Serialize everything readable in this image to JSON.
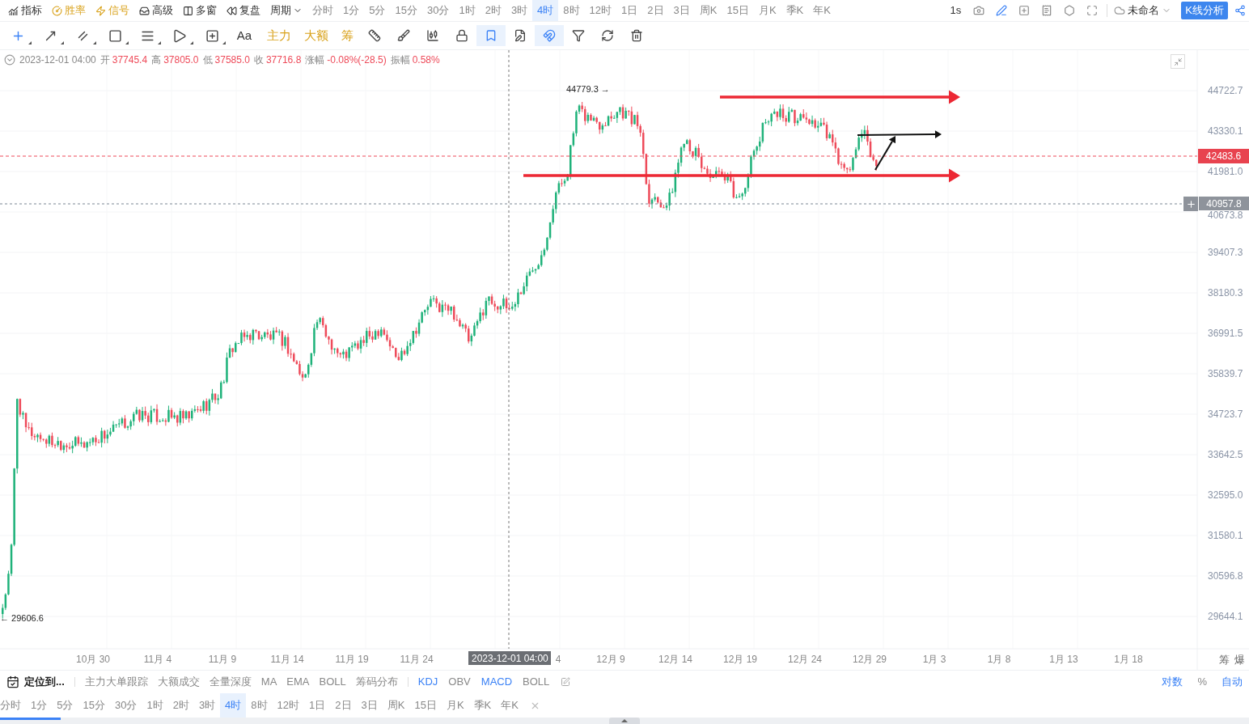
{
  "top_bar": {
    "left_items": [
      {
        "label": "指标",
        "kind": "plain"
      },
      {
        "label": "胜率",
        "kind": "accent"
      },
      {
        "label": "信号",
        "kind": "accent"
      },
      {
        "label": "高级",
        "kind": "plain"
      },
      {
        "label": "多窗",
        "kind": "plain"
      },
      {
        "label": "复盘",
        "kind": "plain"
      }
    ],
    "period_menu": "周期",
    "periods": [
      {
        "label": "分时",
        "selected": false
      },
      {
        "label": "1分",
        "selected": false
      },
      {
        "label": "5分",
        "selected": false
      },
      {
        "label": "15分",
        "selected": false
      },
      {
        "label": "30分",
        "selected": false
      },
      {
        "label": "1时",
        "selected": false
      },
      {
        "label": "2时",
        "selected": false
      },
      {
        "label": "3时",
        "selected": false
      },
      {
        "label": "4时",
        "selected": true
      },
      {
        "label": "8时",
        "selected": false
      },
      {
        "label": "12时",
        "selected": false
      },
      {
        "label": "1日",
        "selected": false
      },
      {
        "label": "2日",
        "selected": false
      },
      {
        "label": "3日",
        "selected": false
      },
      {
        "label": "周K",
        "selected": false
      },
      {
        "label": "15日",
        "selected": false
      },
      {
        "label": "月K",
        "selected": false
      },
      {
        "label": "季K",
        "selected": false
      },
      {
        "label": "年K",
        "selected": false
      }
    ],
    "refresh": "1s",
    "layout_name": "未命名",
    "analysis_button": "K线分析"
  },
  "drawing_toolbar": {
    "text_tool": "Aa",
    "accent_tools": [
      "主力",
      "大额",
      "筹"
    ]
  },
  "ohlc_bar": {
    "datetime": "2023-12-01 04:00",
    "fields": [
      {
        "label": "开",
        "value": "37745.4"
      },
      {
        "label": "高",
        "value": "37805.0"
      },
      {
        "label": "低",
        "value": "37585.0"
      },
      {
        "label": "收",
        "value": "37716.8"
      },
      {
        "label": "涨幅",
        "value": "-0.08%(-28.5)"
      },
      {
        "label": "振幅",
        "value": "0.58%"
      }
    ]
  },
  "chart": {
    "price_ticks": [
      "44722.7",
      "43330.1",
      "41981.0",
      "40673.8",
      "39407.3",
      "38180.3",
      "36991.5",
      "35839.7",
      "34723.7",
      "33642.5",
      "32595.0",
      "31580.1",
      "30596.8",
      "29644.1"
    ],
    "time_ticks": [
      "10月 30",
      "11月 4",
      "11月 9",
      "11月 14",
      "11月 19",
      "11月 24",
      "4",
      "12月 9",
      "12月 14",
      "12月 19",
      "12月 24",
      "12月 29",
      "1月 3",
      "1月 8",
      "1月 13",
      "1月 18"
    ],
    "high_label": "44779.3 →",
    "low_label": "← 29606.6",
    "last_price": "42483.6",
    "cursor_price": "40957.8",
    "cursor_time": "2023-12-01 04:00",
    "axis_tools": [
      "筹",
      "爆"
    ]
  },
  "indicator_bar": {
    "locate": "定位到...",
    "main_indicators": [
      "主力大单跟踪",
      "大额成交",
      "全量深度",
      "MA",
      "EMA",
      "BOLL",
      "筹码分布"
    ],
    "sub_indicators": [
      {
        "label": "KDJ",
        "selected": true
      },
      {
        "label": "OBV",
        "selected": false
      },
      {
        "label": "MACD",
        "selected": true
      },
      {
        "label": "BOLL",
        "selected": false
      }
    ],
    "scale_options": [
      {
        "label": "对数",
        "on": true
      },
      {
        "label": "%",
        "on": false
      },
      {
        "label": "自动",
        "on": true
      }
    ]
  },
  "bottom_periods": [
    {
      "label": "分时",
      "selected": false
    },
    {
      "label": "1分",
      "selected": false
    },
    {
      "label": "5分",
      "selected": false
    },
    {
      "label": "15分",
      "selected": false
    },
    {
      "label": "30分",
      "selected": false
    },
    {
      "label": "1时",
      "selected": false
    },
    {
      "label": "2时",
      "selected": false
    },
    {
      "label": "3时",
      "selected": false
    },
    {
      "label": "4时",
      "selected": true
    },
    {
      "label": "8时",
      "selected": false
    },
    {
      "label": "12时",
      "selected": false
    },
    {
      "label": "1日",
      "selected": false
    },
    {
      "label": "2日",
      "selected": false
    },
    {
      "label": "3日",
      "selected": false
    },
    {
      "label": "周K",
      "selected": false
    },
    {
      "label": "15日",
      "selected": false
    },
    {
      "label": "月K",
      "selected": false
    },
    {
      "label": "季K",
      "selected": false
    },
    {
      "label": "年K",
      "selected": false
    }
  ]
}
